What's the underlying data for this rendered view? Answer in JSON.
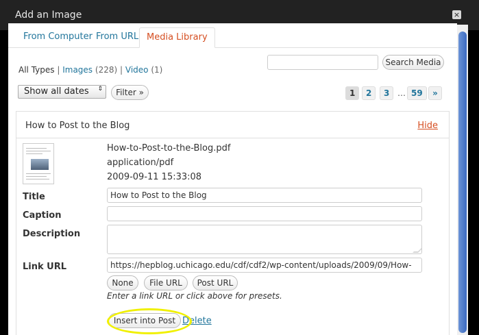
{
  "dialog": {
    "title": "Add an Image",
    "close_label": "×"
  },
  "tabs": [
    {
      "label": "From Computer"
    },
    {
      "label": "From URL"
    },
    {
      "label": "Media Library",
      "active": true
    }
  ],
  "filters": {
    "all_types": "All Types",
    "sep1": "|",
    "images_label": "Images",
    "images_count": "(228)",
    "sep2": "|",
    "video_label": "Video",
    "video_count": "(1)"
  },
  "search": {
    "value": "",
    "button_label": "Search Media"
  },
  "date_filter": {
    "selected": "Show all dates",
    "arrow": "⇕",
    "filter_button": "Filter »"
  },
  "pagination": {
    "pages": [
      "1",
      "2",
      "3"
    ],
    "dots": "…",
    "last": "59",
    "next": "»"
  },
  "item": {
    "header_title": "How to Post to the Blog",
    "hide_label": "Hide",
    "filename": "How-to-Post-to-the-Blog.pdf",
    "mime": "application/pdf",
    "date": "2009-09-11 15:33:08",
    "title_label": "Title",
    "title_value": "How to Post to the Blog",
    "caption_label": "Caption",
    "caption_value": "",
    "description_label": "Description",
    "description_value": "",
    "link_label": "Link URL",
    "link_value": "https://hepblog.uchicago.edu/cdf/cdf2/wp-content/uploads/2009/09/How-",
    "none_button": "None",
    "file_url_button": "File URL",
    "post_url_button": "Post URL",
    "hint": "Enter a link URL or click above for presets.",
    "insert_button": "Insert into Post",
    "delete_label": "Delete"
  },
  "colors": {
    "link": "#21759b",
    "active_tab": "#d54e21",
    "highlight": "#f0f000"
  }
}
